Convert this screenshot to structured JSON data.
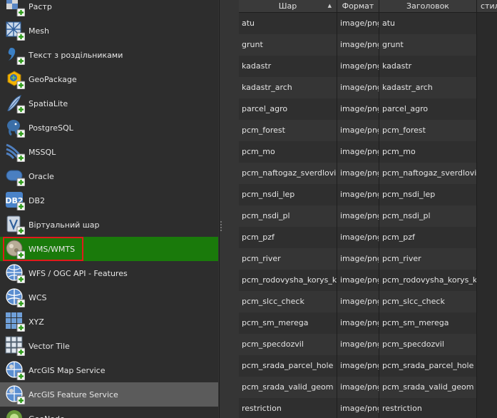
{
  "browser": {
    "items": [
      {
        "label": "Растр",
        "icon": "raster-icon"
      },
      {
        "label": "Mesh",
        "icon": "mesh-icon"
      },
      {
        "label": "Текст з роздільниками",
        "icon": "comma-icon"
      },
      {
        "label": "GeoPackage",
        "icon": "geopackage-icon"
      },
      {
        "label": "SpatiaLite",
        "icon": "feather-icon"
      },
      {
        "label": "PostgreSQL",
        "icon": "elephant-icon"
      },
      {
        "label": "MSSQL",
        "icon": "mssql-icon"
      },
      {
        "label": "Oracle",
        "icon": "oracle-icon"
      },
      {
        "label": "DB2",
        "icon": "db2-icon"
      },
      {
        "label": "Віртуальний шар",
        "icon": "virtual-layer-icon"
      },
      {
        "label": "WMS/WMTS",
        "icon": "globe-wms-icon"
      },
      {
        "label": "WFS / OGC API - Features",
        "icon": "globe-wfs-icon"
      },
      {
        "label": "WCS",
        "icon": "wcs-icon"
      },
      {
        "label": "XYZ",
        "icon": "xyz-grid-icon"
      },
      {
        "label": "Vector Tile",
        "icon": "vector-tile-icon"
      },
      {
        "label": "ArcGIS Map Service",
        "icon": "arcgis-map-icon"
      },
      {
        "label": "ArcGIS Feature Service",
        "icon": "arcgis-feature-icon"
      },
      {
        "label": "GeoNode",
        "icon": "geonode-icon"
      }
    ],
    "selected_index": 10,
    "hover_index": 16,
    "colors": {
      "selected_bg": "#1a7a0b",
      "highlight_border": "#e01b1b",
      "hover_bg": "#5b5b5b"
    }
  },
  "layers_table": {
    "columns": [
      "Шар",
      "Формат",
      "Заголовок",
      "стил"
    ],
    "sort_indicator": "▲",
    "rows": [
      [
        "atu",
        "image/png",
        "atu"
      ],
      [
        "grunt",
        "image/png",
        "grunt"
      ],
      [
        "kadastr",
        "image/png",
        "kadastr"
      ],
      [
        "kadastr_arch",
        "image/png",
        "kadastr_arch"
      ],
      [
        "parcel_agro",
        "image/png",
        "parcel_agro"
      ],
      [
        "pcm_forest",
        "image/png",
        "pcm_forest"
      ],
      [
        "pcm_mo",
        "image/png",
        "pcm_mo"
      ],
      [
        "pcm_naftogaz_sverdlovini",
        "image/png",
        "pcm_naftogaz_sverdlovini"
      ],
      [
        "pcm_nsdi_lep",
        "image/png",
        "pcm_nsdi_lep"
      ],
      [
        "pcm_nsdi_pl",
        "image/png",
        "pcm_nsdi_pl"
      ],
      [
        "pcm_pzf",
        "image/png",
        "pcm_pzf"
      ],
      [
        "pcm_river",
        "image/png",
        "pcm_river"
      ],
      [
        "pcm_rodovysha_korys_kop",
        "image/png",
        "pcm_rodovysha_korys_kop"
      ],
      [
        "pcm_slcc_check",
        "image/png",
        "pcm_slcc_check"
      ],
      [
        "pcm_sm_merega",
        "image/png",
        "pcm_sm_merega"
      ],
      [
        "pcm_specdozvil",
        "image/png",
        "pcm_specdozvil"
      ],
      [
        "pcm_srada_parcel_hole",
        "image/png",
        "pcm_srada_parcel_hole"
      ],
      [
        "pcm_srada_valid_geom",
        "image/png",
        "pcm_srada_valid_geom"
      ],
      [
        "restriction",
        "image/png",
        "restriction"
      ]
    ]
  }
}
